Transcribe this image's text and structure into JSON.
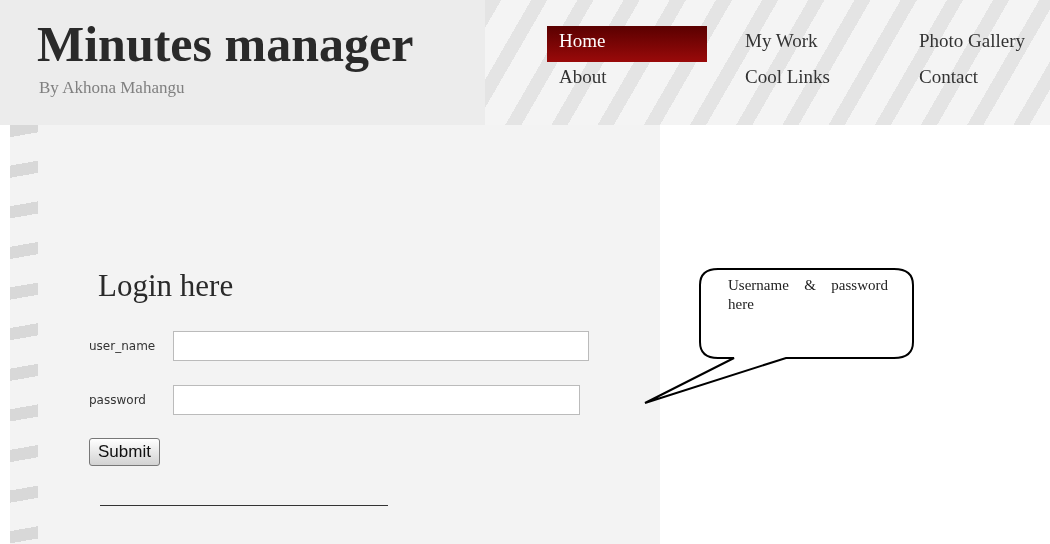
{
  "header": {
    "title": "Minutes manager",
    "byline": "By Akhona Mahangu"
  },
  "nav": [
    {
      "label": "Home",
      "selected": true
    },
    {
      "label": "My Work",
      "selected": false
    },
    {
      "label": "Photo Gallery",
      "selected": false
    },
    {
      "label": "About",
      "selected": false
    },
    {
      "label": "Cool Links",
      "selected": false
    },
    {
      "label": "Contact",
      "selected": false
    }
  ],
  "login": {
    "heading": "Login here",
    "fields": [
      {
        "label": "user_name"
      },
      {
        "label": "password"
      }
    ],
    "submit": "Submit"
  },
  "callout": {
    "text": "Username & password here"
  }
}
